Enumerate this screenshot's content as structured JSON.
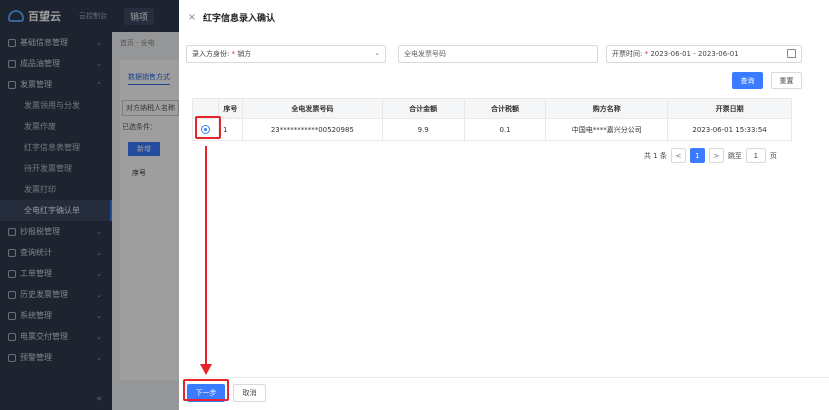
{
  "app": {
    "logo_text": "百望云",
    "logo_sub": "云控制台",
    "top_tab": "销项",
    "breadcrumb": "首页 · 全电",
    "bg_tab": "数据销售方式",
    "bg_line1": "对方纳税人名称",
    "bg_line2": "已选条件：",
    "bg_new_btn": "新增",
    "bg_col": "序号"
  },
  "sidebar": {
    "items": [
      {
        "label": "基础信息管理",
        "expanded": false
      },
      {
        "label": "成品油管理",
        "expanded": false
      },
      {
        "label": "发票管理",
        "expanded": true
      }
    ],
    "subitems": [
      {
        "label": "发票领用与分发",
        "active": false
      },
      {
        "label": "发票作废",
        "active": false
      },
      {
        "label": "红字信息表管理",
        "active": false
      },
      {
        "label": "待开发票管理",
        "active": false
      },
      {
        "label": "发票打印",
        "active": false
      },
      {
        "label": "全电红字确认单",
        "active": true
      }
    ],
    "items_after": [
      {
        "label": "抄报税管理"
      },
      {
        "label": "查询统计"
      },
      {
        "label": "工单管理"
      },
      {
        "label": "历史发票管理"
      },
      {
        "label": "系统管理"
      },
      {
        "label": "电票交付管理"
      },
      {
        "label": "预警管理"
      }
    ],
    "collapse": "«"
  },
  "drawer": {
    "title": "红字信息录入确认",
    "close": "×",
    "filters": {
      "identity_label": "录入方身份:",
      "identity_value": "销方",
      "invoice_placeholder": "全电发票号码",
      "date_label": "开票时间:",
      "date_value": "2023-06-01 - 2023-06-01"
    },
    "query_btn": "查询",
    "reset_btn": "重置",
    "table": {
      "headers": [
        "序号",
        "全电发票号码",
        "合计金额",
        "合计税额",
        "购方名称",
        "开票日期"
      ],
      "rows": [
        {
          "seq": "1",
          "invoice_no": "23***********00520985",
          "amount": "9.9",
          "tax": "0.1",
          "buyer": "中国电****嘉兴分公司",
          "date": "2023-06-01 15:33:54"
        }
      ]
    },
    "pager": {
      "total": "共 1 条",
      "prev": "<",
      "current": "1",
      "next": ">",
      "jump": "跳至",
      "jump_value": "1",
      "page_unit": "页"
    },
    "next_btn": "下一步",
    "cancel_btn": "取消"
  },
  "colors": {
    "primary": "#3a7bff",
    "annotation": "#e8232a",
    "sidebar_bg": "#2f3a4d"
  }
}
